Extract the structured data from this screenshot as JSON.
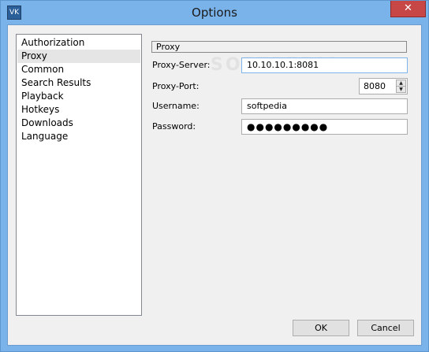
{
  "window": {
    "title": "Options",
    "app_icon_text": "VK",
    "close_glyph": "✕"
  },
  "sidebar": {
    "items": [
      {
        "label": "Authorization"
      },
      {
        "label": "Proxy",
        "selected": true
      },
      {
        "label": "Common"
      },
      {
        "label": "Search Results"
      },
      {
        "label": "Playback"
      },
      {
        "label": "Hotkeys"
      },
      {
        "label": "Downloads"
      },
      {
        "label": "Language"
      }
    ]
  },
  "proxy": {
    "section_title": "Proxy",
    "server_label": "Proxy-Server:",
    "server_value": "10.10.10.1:8081",
    "port_label": "Proxy-Port:",
    "port_value": "8080",
    "username_label": "Username:",
    "username_value": "softpedia",
    "password_label": "Password:",
    "password_value": "●●●●●●●●●"
  },
  "footer": {
    "ok_label": "OK",
    "cancel_label": "Cancel"
  },
  "watermark": "SOFTPEDIA",
  "colors": {
    "titlebar": "#79b3ea",
    "close": "#c74646",
    "dialog_bg": "#f0f0f0"
  }
}
